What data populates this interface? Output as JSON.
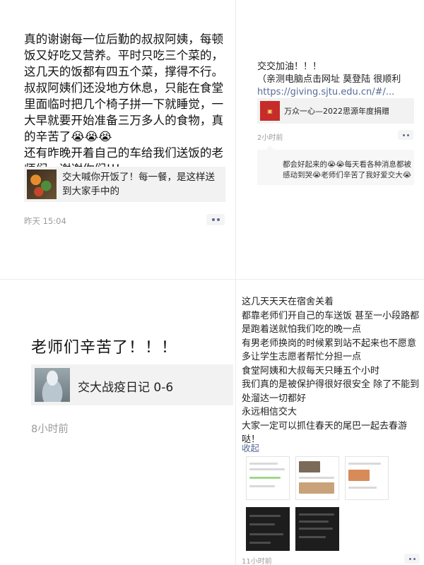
{
  "post1": {
    "text": "真的谢谢每一位后勤的叔叔阿姨，每顿饭又好吃又营养。平时只吃三个菜的，这几天的饭都有四五个菜，撑得不行。叔叔阿姨们还没地方休息，只能在食堂里面临时把几个椅子拼一下就睡觉，一大早就要开始准备三万多人的食物，真的辛苦了😭😭😭\n还有昨晚开着自己的车给我们送饭的老师们，谢谢你们!!!",
    "card_text": "交大喊你开饭了！每一餐，是这样送到大家手中的",
    "time": "昨天 15:04"
  },
  "post2": {
    "text_main": "交交加油！！！\n（亲测电脑点击网址 莫登陆 很顺利",
    "text_link": "https://giving.sjtu.edu.cn/#/...",
    "card_text": "万众一心—2022思源年度捐赠",
    "time": "2小时前",
    "comment": "都会好起来的😭😭每天看各种消息都被感动到哭😭老师们辛苦了我好爱交大😭"
  },
  "post3": {
    "title": "老师们辛苦了！！！",
    "card_text": "交大战疫日记 0-6",
    "time": "8小时前"
  },
  "post4": {
    "text": "这几天天天在宿舍关着\n都靠老师们开自己的车送饭 甚至一小段路都是跑着送就怕我们吃的晚一点\n有男老师换岗的时候累到站不起来也不愿意多让学生志愿者帮忙分担一点\n食堂阿姨和大叔每天只睡五个小时\n我们真的是被保护得很好很安全 除了不能到处溜达一切都好\n永远相信交大\n大家一定可以抓住春天的尾巴一起去春游哒！",
    "collapse": "收起",
    "time": "11小时前"
  }
}
